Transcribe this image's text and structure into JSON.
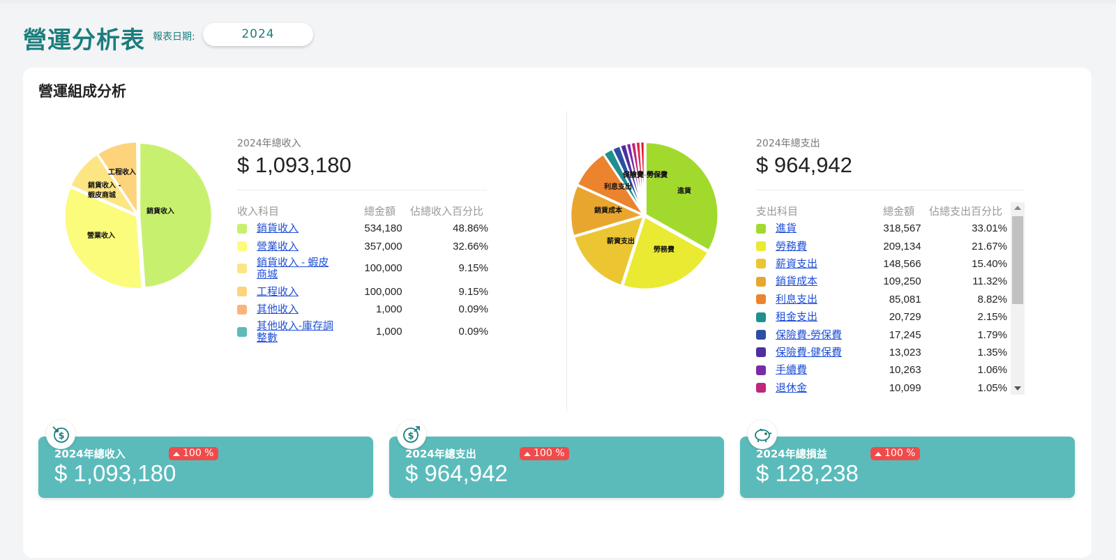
{
  "header": {
    "title": "營運分析表",
    "date_label": "報表日期:",
    "date_value": "2024"
  },
  "section": {
    "title": "營運組成分析"
  },
  "income": {
    "caption": "2024年總收入",
    "total": "$ 1,093,180",
    "columns": [
      "收入科目",
      "總金額",
      "佔總收入百分比"
    ],
    "rows": [
      {
        "name": "銷貨收入",
        "amount": "534,180",
        "pct": "48.86%",
        "color": "#c8f06f"
      },
      {
        "name": "營業收入",
        "amount": "357,000",
        "pct": "32.66%",
        "color": "#fbfb7c"
      },
      {
        "name": "銷貨收入 - 蝦皮商城",
        "amount": "100,000",
        "pct": "9.15%",
        "color": "#fde584"
      },
      {
        "name": "工程收入",
        "amount": "100,000",
        "pct": "9.15%",
        "color": "#fdd47c"
      },
      {
        "name": "其他收入",
        "amount": "1,000",
        "pct": "0.09%",
        "color": "#fbb37d"
      },
      {
        "name": "其他收入-庫存調整數",
        "amount": "1,000",
        "pct": "0.09%",
        "color": "#5bbbbb"
      }
    ],
    "pie_labels": [
      "銷貨收入",
      "營業收入",
      "銷貨收入 -",
      "蝦皮商城",
      "工程收入"
    ]
  },
  "expense": {
    "caption": "2024年總支出",
    "total": "$ 964,942",
    "columns": [
      "支出科目",
      "總金額",
      "佔總支出百分比"
    ],
    "rows": [
      {
        "name": "進貨",
        "amount": "318,567",
        "pct": "33.01%",
        "color": "#a2d92d"
      },
      {
        "name": "勞務費",
        "amount": "209,134",
        "pct": "21.67%",
        "color": "#eaea32"
      },
      {
        "name": "薪資支出",
        "amount": "148,566",
        "pct": "15.40%",
        "color": "#ebc632"
      },
      {
        "name": "銷貨成本",
        "amount": "109,250",
        "pct": "11.32%",
        "color": "#e9a62f"
      },
      {
        "name": "利息支出",
        "amount": "85,081",
        "pct": "8.82%",
        "color": "#ec832f"
      },
      {
        "name": "租金支出",
        "amount": "20,729",
        "pct": "2.15%",
        "color": "#1f8f8f"
      },
      {
        "name": "保險費-勞保費",
        "amount": "17,245",
        "pct": "1.79%",
        "color": "#2c4fa3"
      },
      {
        "name": "保險費-健保費",
        "amount": "13,023",
        "pct": "1.35%",
        "color": "#4d2fa0"
      },
      {
        "name": "手續費",
        "amount": "10,263",
        "pct": "1.06%",
        "color": "#7a2aa8"
      },
      {
        "name": "退休金",
        "amount": "10,099",
        "pct": "1.05%",
        "color": "#c0267a"
      }
    ],
    "extra_slices": [
      {
        "color": "#e12a4e",
        "pct": 1.0
      },
      {
        "color": "#e8132b",
        "pct": 0.9
      }
    ],
    "pie_labels": [
      "進貨",
      "勞務費",
      "薪資支出",
      "銷貨成本",
      "利息支出",
      "保險費-勞保費"
    ]
  },
  "stats": [
    {
      "label": "2024年總收入",
      "amount": "$ 1,093,180",
      "badge": "100 %",
      "icon": "income-dollar-icon"
    },
    {
      "label": "2024年總支出",
      "amount": "$ 964,942",
      "badge": "100 %",
      "icon": "expense-dollar-icon"
    },
    {
      "label": "2024年總損益",
      "amount": "$ 128,238",
      "badge": "100 %",
      "icon": "piggy-bank-icon"
    }
  ]
}
